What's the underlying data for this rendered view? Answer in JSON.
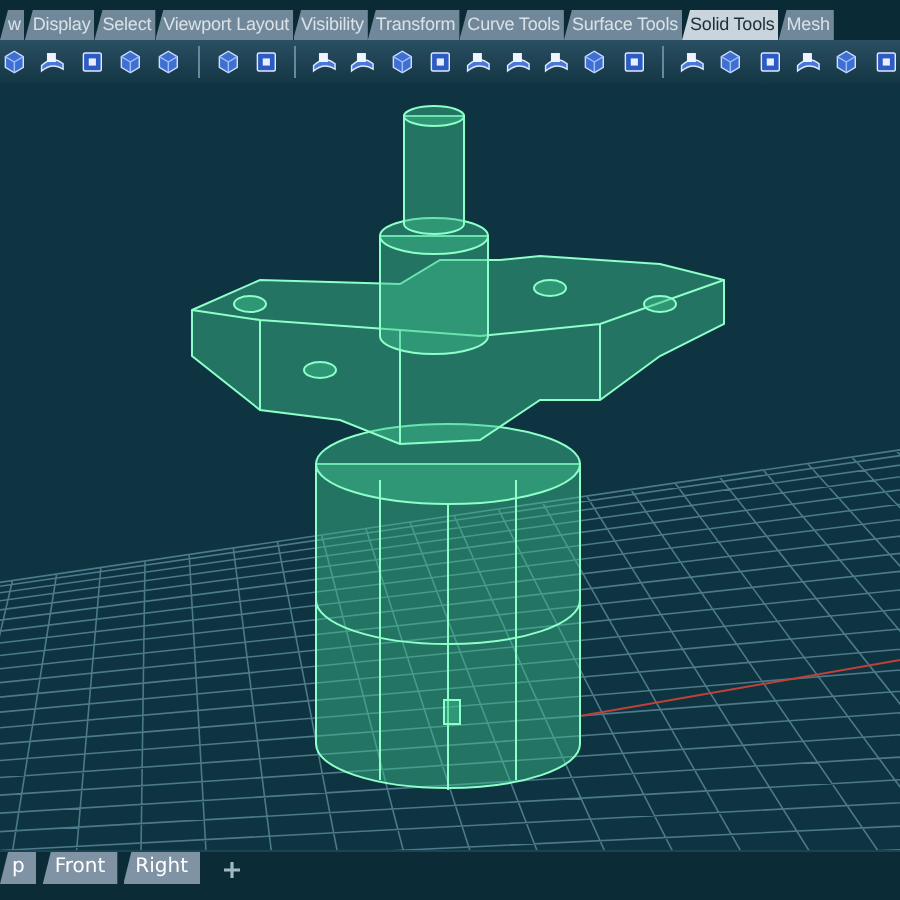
{
  "ribbon_tabs": [
    {
      "label": "w",
      "selected": false
    },
    {
      "label": "Display",
      "selected": false
    },
    {
      "label": "Select",
      "selected": false
    },
    {
      "label": "Viewport Layout",
      "selected": false
    },
    {
      "label": "Visibility",
      "selected": false
    },
    {
      "label": "Transform",
      "selected": false
    },
    {
      "label": "Curve Tools",
      "selected": false
    },
    {
      "label": "Surface Tools",
      "selected": false
    },
    {
      "label": "Solid Tools",
      "selected": true
    },
    {
      "label": "Mesh",
      "selected": false
    }
  ],
  "viewport_tabs": [
    {
      "label": "p",
      "selected": false
    },
    {
      "label": "Front",
      "selected": false
    },
    {
      "label": "Right",
      "selected": false
    }
  ]
}
